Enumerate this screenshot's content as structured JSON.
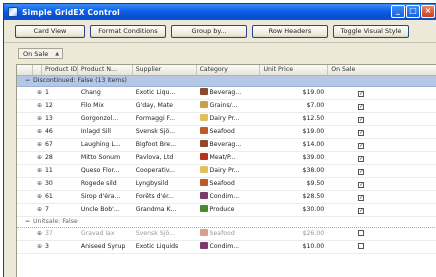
{
  "window": {
    "title": "Simple GridEX Control"
  },
  "toolbar": {
    "buttons": [
      "Card View",
      "Format Conditions",
      "Group by...",
      "Row Headers",
      "Toggle Visual Style"
    ]
  },
  "group_panel": {
    "chip_label": "On Sale"
  },
  "grid": {
    "columns": [
      "",
      "Product ID",
      "Product N...",
      "Supplier",
      "Category",
      "Unit Price",
      "On Sale"
    ],
    "groups": [
      {
        "label": "Discontinued: False (13 items)",
        "rows": [
          {
            "id": "1",
            "name": "Chang",
            "supplier": "Exotic Liqu...",
            "category": "Beverag...",
            "price": "$19.00",
            "on_sale": true,
            "cat_color": "#8b4a2b"
          },
          {
            "id": "12",
            "name": "Filo Mix",
            "supplier": "G'day, Mate",
            "category": "Grains/...",
            "price": "$7.00",
            "on_sale": true,
            "cat_color": "#c9a14a"
          },
          {
            "id": "13",
            "name": "Gorgonzol...",
            "supplier": "Formaggi F...",
            "category": "Dairy Pr...",
            "price": "$12.50",
            "on_sale": true,
            "cat_color": "#e0c060"
          },
          {
            "id": "46",
            "name": "Inlagd Sill",
            "supplier": "Svensk Sjö...",
            "category": "Seafood",
            "price": "$19.00",
            "on_sale": true,
            "cat_color": "#c05a2a"
          },
          {
            "id": "67",
            "name": "Laughing L...",
            "supplier": "Bigfoot Bre...",
            "category": "Beverag...",
            "price": "$14.00",
            "on_sale": true,
            "cat_color": "#8b4a2b"
          },
          {
            "id": "28",
            "name": "Mitto Sonum",
            "supplier": "Pavlova, Ltd",
            "category": "Meat/P...",
            "price": "$39.00",
            "on_sale": true,
            "cat_color": "#b8321f"
          },
          {
            "id": "11",
            "name": "Queso Flor...",
            "supplier": "Cooperativ...",
            "category": "Dairy Pr...",
            "price": "$38.00",
            "on_sale": true,
            "cat_color": "#e0c060"
          },
          {
            "id": "30",
            "name": "Rogede sild",
            "supplier": "Lyngbysild",
            "category": "Seafood",
            "price": "$9.50",
            "on_sale": true,
            "cat_color": "#c05a2a"
          },
          {
            "id": "61",
            "name": "Sirop d'éra...",
            "supplier": "Forêts d'ér...",
            "category": "Condim...",
            "price": "$28.50",
            "on_sale": true,
            "cat_color": "#7a3a6a"
          },
          {
            "id": "7",
            "name": "Uncle Bob'...",
            "supplier": "Grandma K...",
            "category": "Produce",
            "price": "$30.00",
            "on_sale": true,
            "cat_color": "#4a8a2a"
          }
        ]
      },
      {
        "label": "Unitsale: False",
        "rows": [
          {
            "id": "37",
            "name": "Gravad lax",
            "supplier": "Svensk Sjö...",
            "category": "Seafood",
            "price": "$26.00",
            "on_sale": false,
            "cat_color": "#d9a090",
            "dim": true
          },
          {
            "id": "3",
            "name": "Aniseed Syrup",
            "supplier": "Exotic Liquids",
            "category": "Condim...",
            "price": "$10.00",
            "on_sale": false,
            "cat_color": "#7a3a6a"
          }
        ]
      }
    ]
  }
}
